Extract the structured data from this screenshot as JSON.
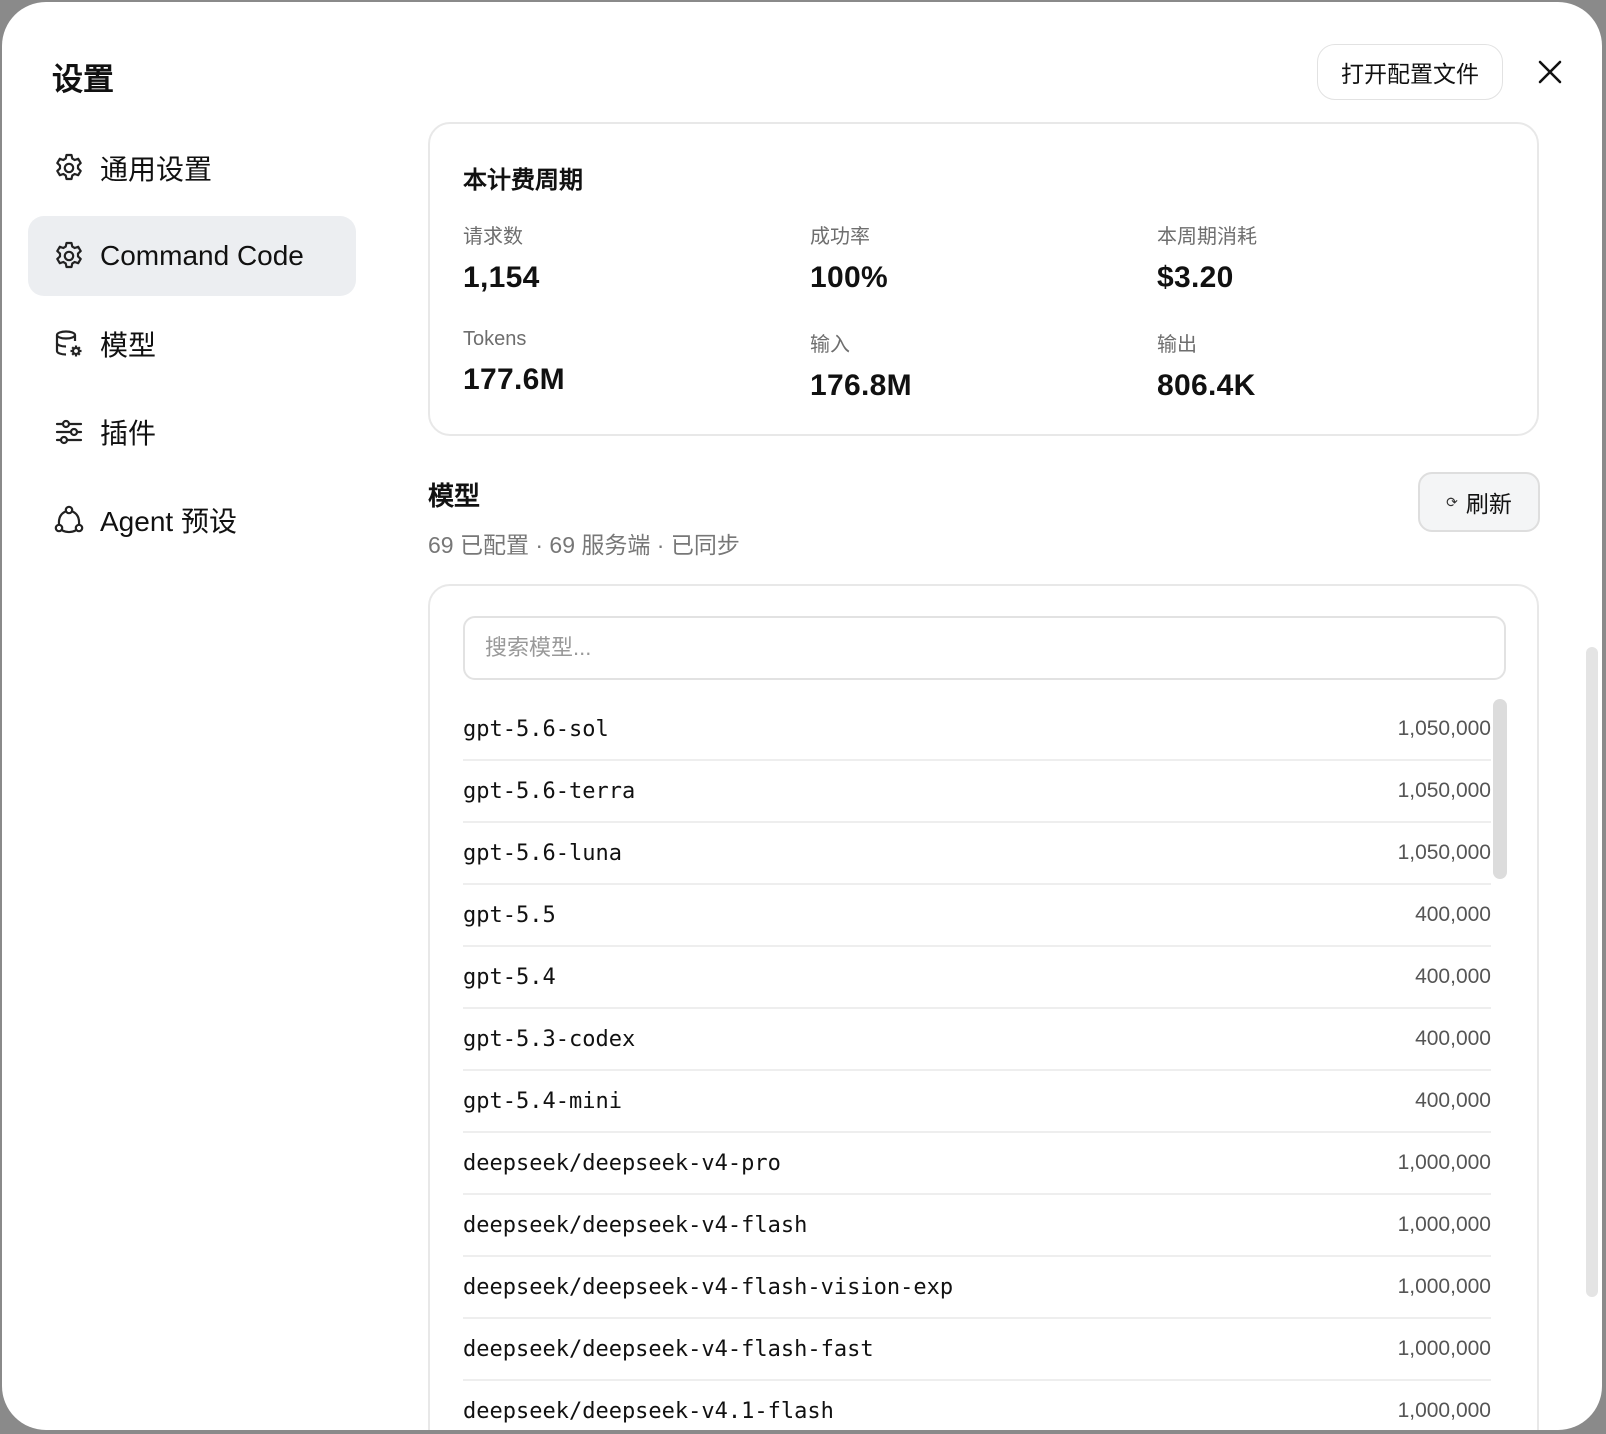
{
  "window": {
    "title": "设置"
  },
  "header": {
    "open_config_label": "打开配置文件"
  },
  "sidebar": {
    "items": [
      {
        "label": "通用设置",
        "icon": "gear-icon",
        "active": false
      },
      {
        "label": "Command Code",
        "icon": "gear-icon",
        "active": true
      },
      {
        "label": "模型",
        "icon": "database-gear-icon",
        "active": false
      },
      {
        "label": "插件",
        "icon": "sliders-icon",
        "active": false
      },
      {
        "label": "Agent 预设",
        "icon": "agent-network-icon",
        "active": false
      }
    ]
  },
  "billing": {
    "title": "本计费周期",
    "stats": [
      {
        "label": "请求数",
        "value": "1,154"
      },
      {
        "label": "成功率",
        "value": "100%"
      },
      {
        "label": "本周期消耗",
        "value": "$3.20"
      },
      {
        "label": "Tokens",
        "value": "177.6M"
      },
      {
        "label": "输入",
        "value": "176.8M"
      },
      {
        "label": "输出",
        "value": "806.4K"
      }
    ]
  },
  "models": {
    "heading": "模型",
    "subtitle": "69 已配置 · 69 服务端 · 已同步",
    "refresh_label": "刷新",
    "search_placeholder": "搜索模型...",
    "list": [
      {
        "name": "gpt-5.6-sol",
        "context": "1,050,000"
      },
      {
        "name": "gpt-5.6-terra",
        "context": "1,050,000"
      },
      {
        "name": "gpt-5.6-luna",
        "context": "1,050,000"
      },
      {
        "name": "gpt-5.5",
        "context": "400,000"
      },
      {
        "name": "gpt-5.4",
        "context": "400,000"
      },
      {
        "name": "gpt-5.3-codex",
        "context": "400,000"
      },
      {
        "name": "gpt-5.4-mini",
        "context": "400,000"
      },
      {
        "name": "deepseek/deepseek-v4-pro",
        "context": "1,000,000"
      },
      {
        "name": "deepseek/deepseek-v4-flash",
        "context": "1,000,000"
      },
      {
        "name": "deepseek/deepseek-v4-flash-vision-exp",
        "context": "1,000,000"
      },
      {
        "name": "deepseek/deepseek-v4-flash-fast",
        "context": "1,000,000"
      },
      {
        "name": "deepseek/deepseek-v4.1-flash",
        "context": "1,000,000"
      }
    ]
  }
}
